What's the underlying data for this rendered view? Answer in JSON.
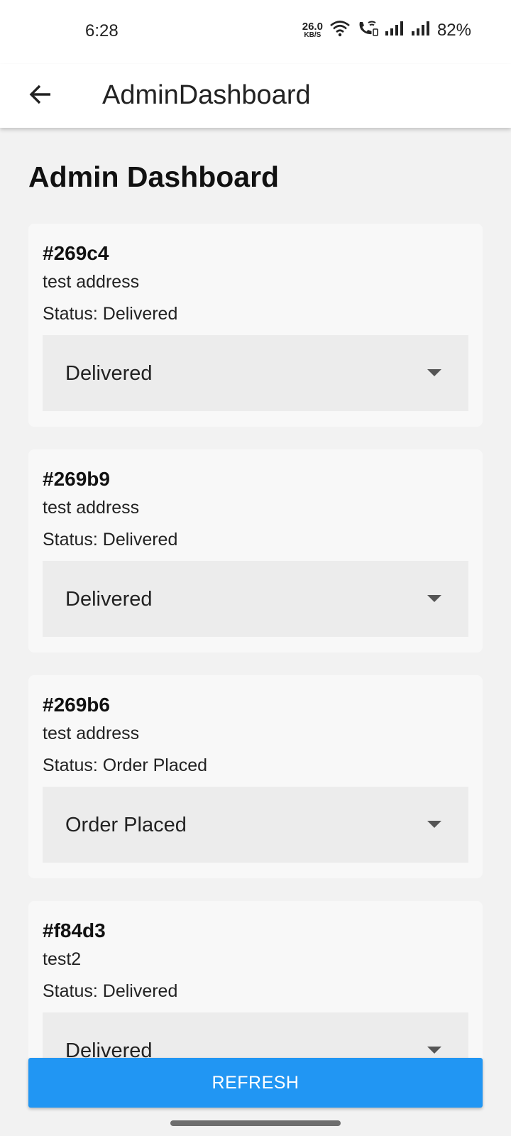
{
  "status_bar": {
    "time": "6:28",
    "net_speed": "26.0",
    "net_unit": "KB/S",
    "battery": "82%",
    "icons": [
      "wifi-icon",
      "wifi-calling-icon",
      "signal-icon",
      "signal-icon",
      "battery-text"
    ]
  },
  "app_bar": {
    "title": "AdminDashboard",
    "back_icon": "arrow-back-icon"
  },
  "page": {
    "title": "Admin Dashboard"
  },
  "orders": [
    {
      "id": "#269c4",
      "address": "test address",
      "status": "Status: Delivered",
      "selected": "Delivered"
    },
    {
      "id": "#269b9",
      "address": "test address",
      "status": "Status: Delivered",
      "selected": "Delivered"
    },
    {
      "id": "#269b6",
      "address": "test address",
      "status": "Status: Order Placed",
      "selected": "Order Placed"
    },
    {
      "id": "#f84d3",
      "address": "test2",
      "status": "Status: Delivered",
      "selected": "Delivered"
    }
  ],
  "actions": {
    "refresh_label": "REFRESH"
  },
  "colors": {
    "accent": "#2196f3",
    "background": "#f2f2f2",
    "card": "#f8f8f8",
    "select": "#ececec"
  }
}
